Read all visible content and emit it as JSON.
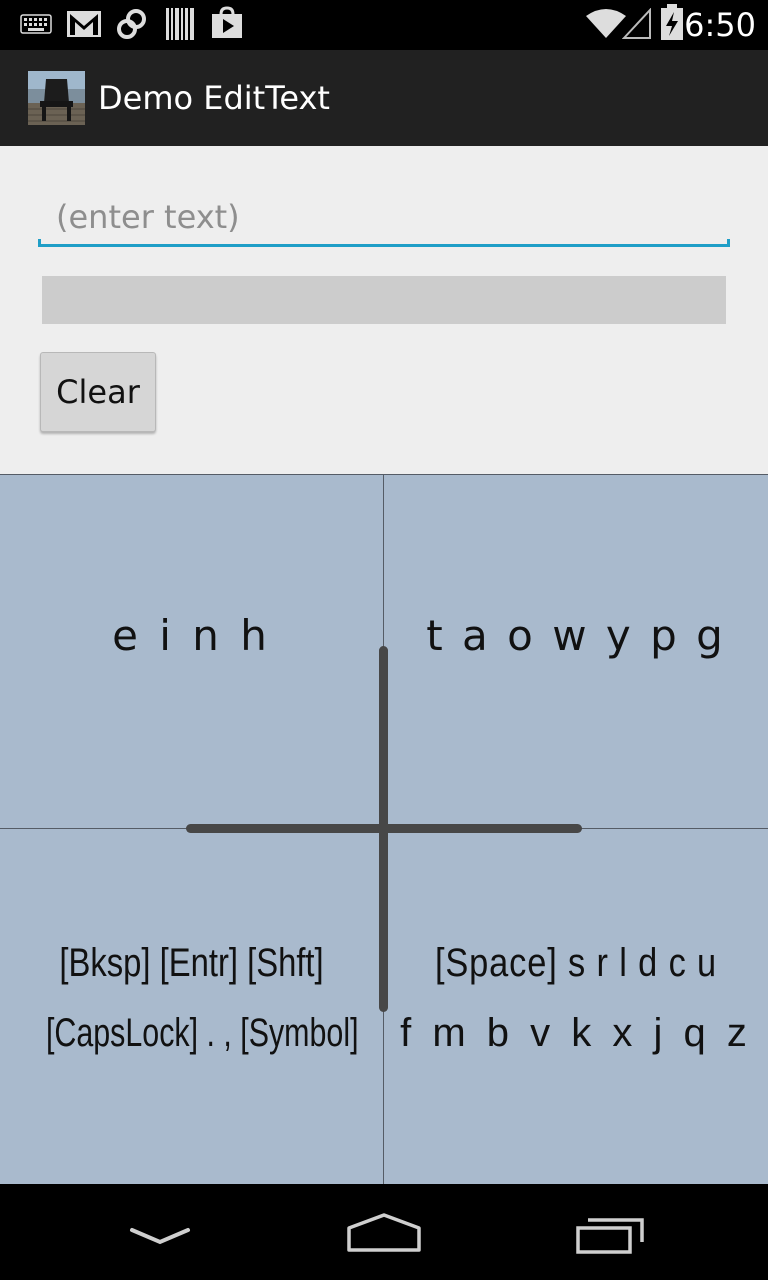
{
  "status_bar": {
    "time": "6:50",
    "icons": [
      "keyboard-icon",
      "gmail-icon",
      "link-icon",
      "barcode-icon",
      "play-store-icon",
      "wifi-icon",
      "signal-icon",
      "battery-icon"
    ]
  },
  "action_bar": {
    "app_title": "Demo EditText",
    "app_icon": "app-chair-icon"
  },
  "editor": {
    "placeholder": "(enter text)",
    "value": "",
    "output_text": "",
    "clear_label": "Clear"
  },
  "keyboard": {
    "top_left": "e i n h",
    "top_right": "t a o w y p g",
    "bottom_left_line1": "[Bksp] [Entr] [Shft]",
    "bottom_left_line2": "[CapsLock] . , [Symbol]",
    "bottom_right_line1": "[Space] s r l d c u",
    "bottom_right_line2": "f m b v k x j q z"
  },
  "nav_bar": {
    "buttons": [
      "back-icon",
      "home-icon",
      "recent-apps-icon"
    ]
  },
  "colors": {
    "accent": "#1f9ec7",
    "keyboard_bg": "#a9bacd",
    "action_bar_bg": "#212121",
    "content_bg": "#eeeeee"
  }
}
